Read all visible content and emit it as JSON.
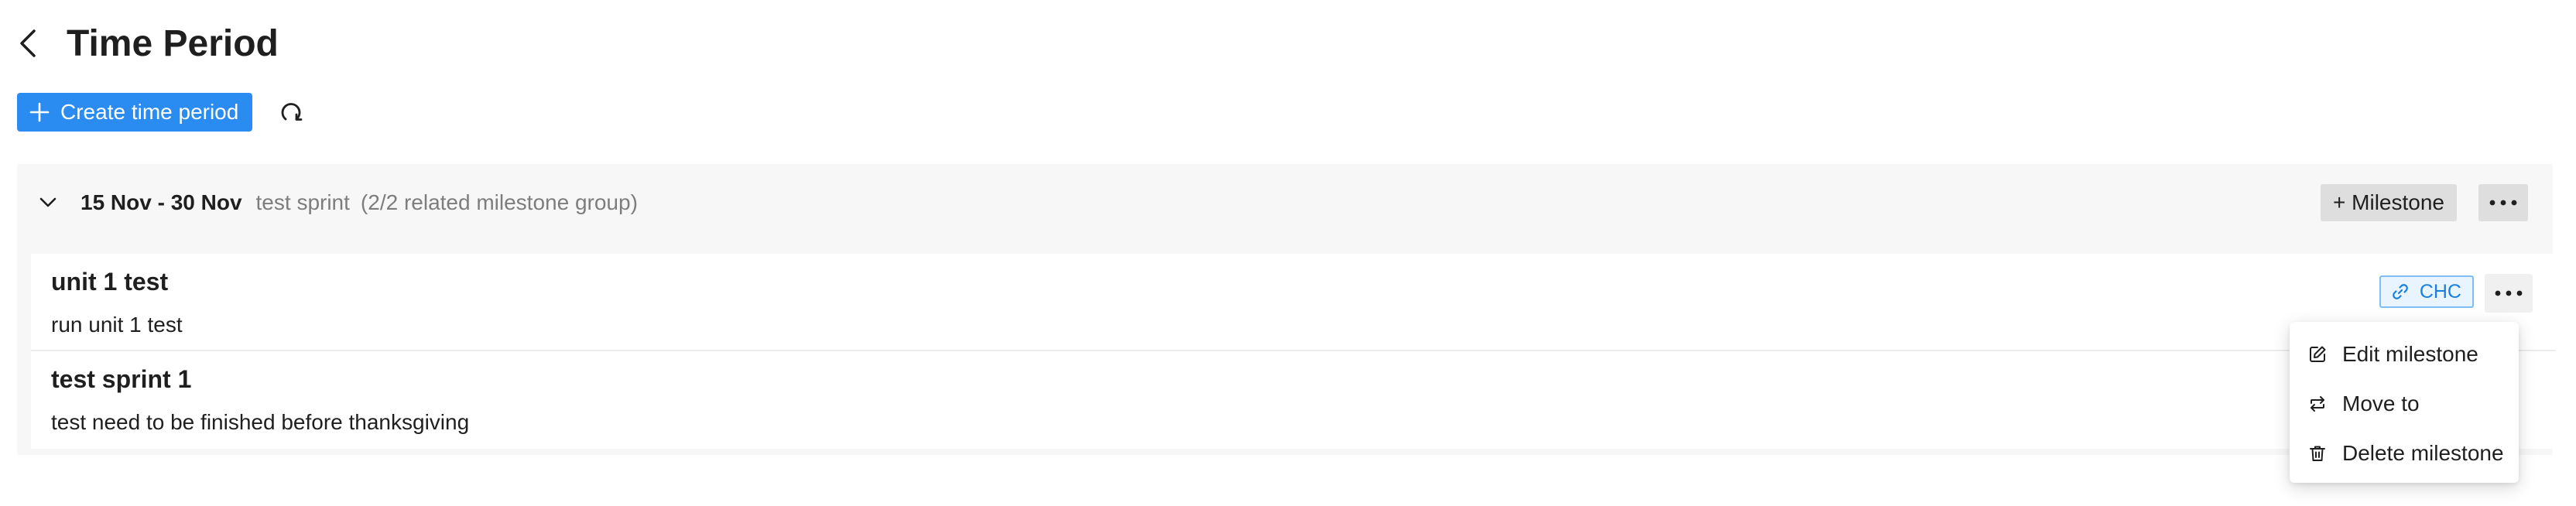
{
  "page": {
    "title": "Time Period"
  },
  "toolbar": {
    "create_label": "Create time period"
  },
  "group": {
    "date_range": "15 Nov - 30 Nov",
    "sprint_name": "test sprint",
    "related_count": "(2/2 related milestone group)",
    "milestone_button": "+ Milestone"
  },
  "milestones": [
    {
      "title": "unit 1 test",
      "description": "run unit 1 test",
      "tag": "CHC"
    },
    {
      "title": "test sprint 1",
      "description": "test need to be finished before thanksgiving"
    }
  ],
  "menu": {
    "items": [
      {
        "label": "Edit milestone",
        "icon": "edit-icon"
      },
      {
        "label": "Move to",
        "icon": "swap-icon"
      },
      {
        "label": "Delete milestone",
        "icon": "trash-icon"
      }
    ]
  },
  "colors": {
    "primary": "#2a8cf0",
    "tag_border": "#7fbdf5",
    "tag_text": "#1a7fe0",
    "group_background": "#f7f7f7",
    "secondary_text": "#7d7d7d"
  }
}
